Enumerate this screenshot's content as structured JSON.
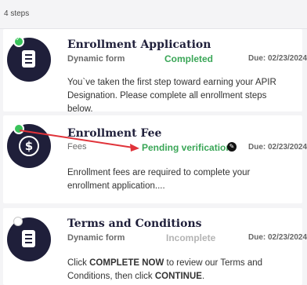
{
  "header": {
    "steps_count": "4 steps"
  },
  "steps": [
    {
      "title": "Enrollment Application",
      "type": "Dynamic form",
      "status": "Completed",
      "due": "Due: 02/23/2024",
      "description": "You`ve taken the first step toward earning your APIR Designation. Please complete all enrollment steps below.",
      "icon": "form-icon"
    },
    {
      "title": "Enrollment Fee",
      "type": "Fees",
      "status": "Pending verification",
      "due": "Due: 02/23/2024",
      "description": "Enrollment fees are required to complete your enrollment application....",
      "icon": "dollar-icon"
    },
    {
      "title": "Terms and Conditions",
      "type": "Dynamic form",
      "status": "Incomplete",
      "due": "Due: 02/23/2024",
      "description_parts": [
        "Click ",
        "COMPLETE NOW",
        " to review our Terms and Conditions, then click ",
        "CONTINUE",
        "."
      ],
      "icon": "form-icon"
    }
  ],
  "colors": {
    "icon_bg": "#1f1f3a",
    "status_green": "#3aa657",
    "status_gray": "#b4b4b4",
    "annotation_red": "#e0333a"
  }
}
